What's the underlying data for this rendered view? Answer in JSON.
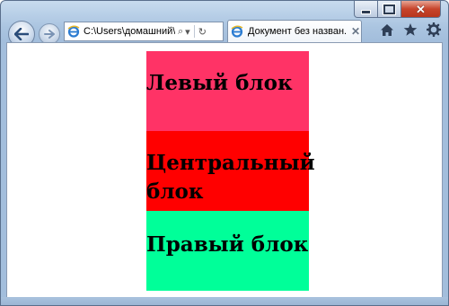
{
  "window": {
    "caption_buttons": {
      "minimize": "minimize",
      "maximize": "maximize",
      "close": "✕"
    }
  },
  "nav": {
    "back_icon": "back-arrow-icon",
    "forward_icon": "forward-arrow-icon"
  },
  "address_bar": {
    "value": "C:\\Users\\домашний\\",
    "search_icon": "⌕",
    "dropdown_icon": "▾",
    "refresh_icon": "↻"
  },
  "tab": {
    "title": "Документ без назван...",
    "close": "✕"
  },
  "toolbar": {
    "icons": [
      "home-icon",
      "favorites-star-icon",
      "tools-gear-icon"
    ]
  },
  "colors": {
    "left_block": "#ff3366",
    "center_block": "#ff0000",
    "right_block": "#00ff99"
  },
  "page": {
    "blocks": {
      "left": "Левый блок",
      "center": "Центральный блок",
      "right": "Правый блок"
    }
  }
}
